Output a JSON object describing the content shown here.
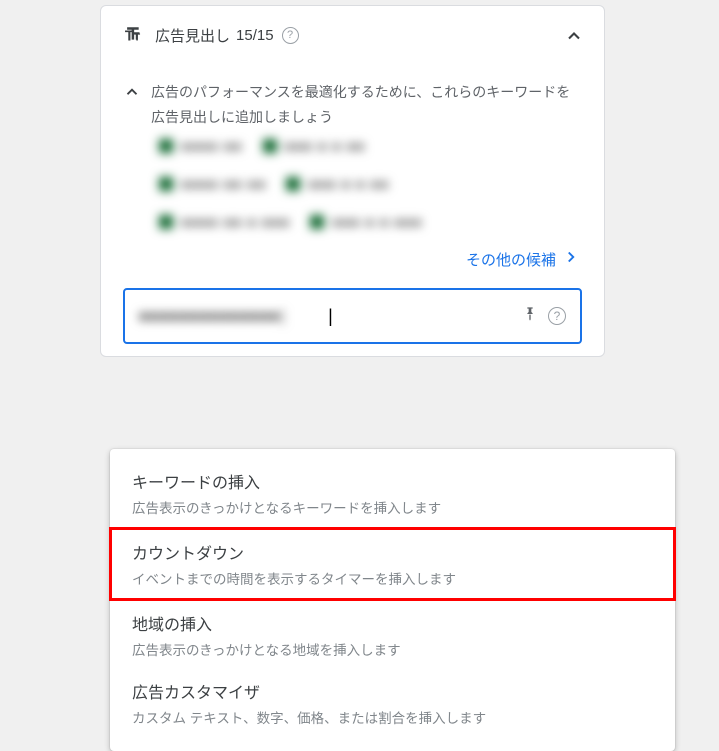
{
  "panel": {
    "title": "広告見出し",
    "count": "15/15",
    "help": "?"
  },
  "suggestion": {
    "text": "広告のパフォーマンスを最適化するために、これらのキーワードを広告見出しに追加しましょう"
  },
  "keywords": {
    "rows": [
      [
        {
          "text": "■■■■ ■■"
        },
        {
          "text": "■■■ ■ ■ ■■"
        }
      ],
      [
        {
          "text": "■■■■ ■■ ■■"
        },
        {
          "text": "■■■ ■ ■ ■■"
        }
      ],
      [
        {
          "text": "■■■■ ■■ ■ ■■■"
        },
        {
          "text": "■■■ ■ ■ ■■■"
        }
      ]
    ]
  },
  "more_link": "その他の候補",
  "input": {
    "value_blurred": "■■■■■■■■■■■■■■{",
    "help": "?"
  },
  "dropdown": {
    "items": [
      {
        "title": "キーワードの挿入",
        "desc": "広告表示のきっかけとなるキーワードを挿入します",
        "highlight": false
      },
      {
        "title": "カウントダウン",
        "desc": "イベントまでの時間を表示するタイマーを挿入します",
        "highlight": true
      },
      {
        "title": "地域の挿入",
        "desc": "広告表示のきっかけとなる地域を挿入します",
        "highlight": false
      },
      {
        "title": "広告カスタマイザ",
        "desc": "カスタム テキスト、数字、価格、または割合を挿入します",
        "highlight": false
      }
    ]
  }
}
